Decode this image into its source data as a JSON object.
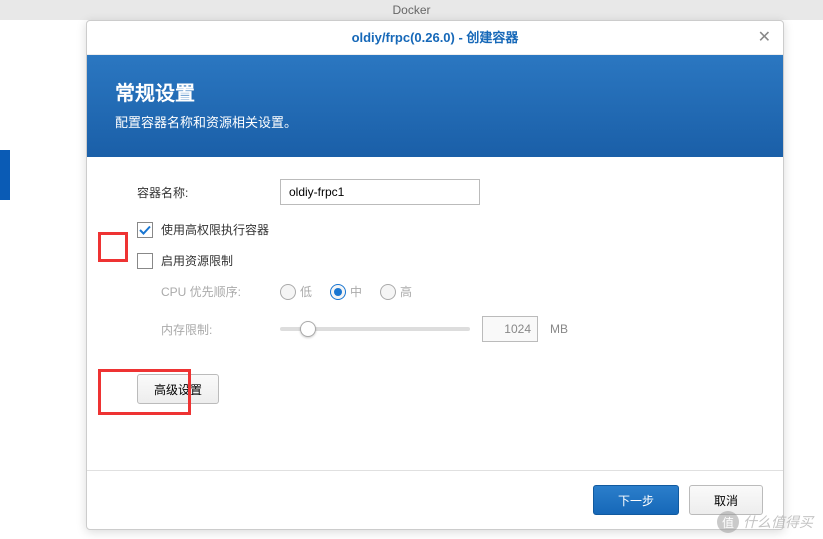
{
  "bg": {
    "app_title": "Docker"
  },
  "dialog": {
    "title": "oldiy/frpc(0.26.0) - 创建容器",
    "banner": {
      "heading": "常规设置",
      "subtitle": "配置容器名称和资源相关设置。"
    },
    "form": {
      "name_label": "容器名称:",
      "name_value": "oldiy-frpc1",
      "priv_label": "使用高权限执行容器",
      "priv_checked": true,
      "resource_label": "启用资源限制",
      "resource_checked": false,
      "cpu_label": "CPU 优先顺序:",
      "cpu_options": {
        "low": "低",
        "med": "中",
        "high": "高"
      },
      "cpu_selected": "med",
      "mem_label": "内存限制:",
      "mem_value": "1024",
      "mem_unit": "MB",
      "advanced_btn": "高级设置"
    },
    "footer": {
      "next": "下一步",
      "cancel": "取消"
    }
  },
  "watermark": "什么值得买"
}
